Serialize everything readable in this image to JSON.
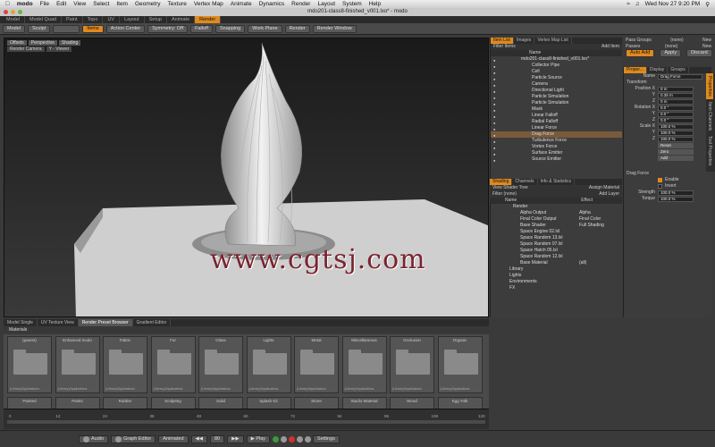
{
  "menubar": {
    "app": "modo",
    "items": [
      "File",
      "Edit",
      "View",
      "Select",
      "Item",
      "Geometry",
      "Texture",
      "Vertex Map",
      "Animate",
      "Dynamics",
      "Render",
      "Layout",
      "System",
      "Help"
    ],
    "clock": "Wed Nov 27  9:20 PM"
  },
  "window": {
    "title": "mdo201-class8-finished_v001.lxo* - modo"
  },
  "layout_tabs": [
    "Model",
    "Model Quad",
    "Paint",
    "Topo",
    "UV",
    "Layout",
    "Setup",
    "Animate",
    "Render"
  ],
  "toolbar": {
    "mode": "Model",
    "sculpt": "Sculpt",
    "items": "Items",
    "action_center": "Action Center",
    "symmetry": "Symmetry: Off",
    "falloff": "Falloff",
    "snapping": "Snapping",
    "work_plane": "Work Plane",
    "render": "Render",
    "render_window": "Render Window"
  },
  "viewport": {
    "tabs": [
      "Offsets",
      "Perspective",
      "Shading"
    ],
    "tabs2": [
      "Render Camera",
      "Y - Viewer"
    ],
    "watermark": "www.cgtsj.com"
  },
  "items_panel": {
    "tabs": [
      "Item List",
      "Images",
      "Vertex Map List"
    ],
    "filter": "Filter Items",
    "add": "Add Item",
    "header": "Name",
    "rows": [
      "mdo201-class8-finished_v001.lxo*",
      "Collector Pipe",
      "Cell",
      "Particle Source",
      "Camera",
      "Directional Light",
      "Particle Simulation",
      "Particle Simulation",
      "Mask",
      "Linear Falloff",
      "Radial Falloff",
      "Linear Force",
      "Drag Force",
      "Turbulence Force",
      "Vortex Force",
      "Surface Emitter",
      "Source Emitter"
    ],
    "selected": 12
  },
  "shading_panel": {
    "tabs": [
      "Shading",
      "Channels",
      "Info & Statistics"
    ],
    "view_label": "View",
    "view_value": "Shader Tree",
    "assign": "Assign Material",
    "filter_label": "Filter",
    "filter_value": "(none)",
    "add_layer": "Add Layer",
    "col_name": "Name",
    "col_effect": "Effect",
    "rows": [
      {
        "name": "Render",
        "effect": ""
      },
      {
        "name": "Alpha Output",
        "effect": "Alpha"
      },
      {
        "name": "Final Color Output",
        "effect": "Final Color"
      },
      {
        "name": "Base Shader",
        "effect": "Full Shading"
      },
      {
        "name": "Space Engine 02.lxl",
        "effect": ""
      },
      {
        "name": "Space Random 13.lxl",
        "effect": ""
      },
      {
        "name": "Space Random 07.lxl",
        "effect": ""
      },
      {
        "name": "Space Hatch 05.lxl",
        "effect": ""
      },
      {
        "name": "Space Random 12.lxl",
        "effect": ""
      },
      {
        "name": "Base Material",
        "effect": "(all)"
      },
      {
        "name": "Library",
        "effect": ""
      },
      {
        "name": "Lights",
        "effect": ""
      },
      {
        "name": "Environments",
        "effect": ""
      },
      {
        "name": "FX",
        "effect": ""
      }
    ]
  },
  "top_right": {
    "pass_groups": "Pass Groups",
    "passes": "Passes",
    "none1": "(none)",
    "none2": "(none)",
    "new": "New",
    "auto_add": "Auto Add",
    "apply": "Apply",
    "discard": "Discard"
  },
  "properties": {
    "tabs": [
      "Proper...",
      "Display",
      "Groups"
    ],
    "name_label": "Name",
    "name_value": "Drag Force",
    "transform": "Transform",
    "position_label": "Position X",
    "position": [
      "0 m",
      "0.35 m",
      "0 m"
    ],
    "rotation_label": "Rotation X",
    "rotation": [
      "0.0 °",
      "0.0 °",
      "0.0 °"
    ],
    "scale_label": "Scale X",
    "scale": [
      "100.0 %",
      "100.0 %",
      "100.0 %"
    ],
    "reset": "Reset",
    "zero": "Zero",
    "add": "Add",
    "drag_force": "Drag Force",
    "enable": "Enable",
    "invert": "Invert",
    "strength_label": "Strength",
    "strength": "100.0 %",
    "torque_label": "Torque",
    "torque": "100.0 %"
  },
  "side_tabs": [
    "Properties",
    "Item Channels",
    "Tool Properties"
  ],
  "bottom_tabs": [
    "Model Single",
    "UV Texture View",
    "Render Preset Browser",
    "Gradient Editor"
  ],
  "preset_path": "Materials",
  "preset_folders": [
    "(parent)",
    "Enhanced modo",
    "Fabric",
    "Fur",
    "Glass",
    "Lights",
    "Metal",
    "Miscellaneous",
    "Occlusion",
    "Organic"
  ],
  "preset_folders_row2": [
    "Painted",
    "Paints",
    "Rubber",
    "Sculpting",
    "Solid",
    "Splash Kit",
    "Stone",
    "Studio Material",
    "Wood",
    "Egg Yolk"
  ],
  "preset_path_label": "(Library)/Applications",
  "timeline_ticks": [
    "0",
    "12",
    "24",
    "36",
    "48",
    "60",
    "72",
    "84",
    "96",
    "108",
    "120"
  ],
  "playbar": {
    "audio": "Audio",
    "graph": "Graph Editor",
    "animated": "Animated",
    "frame": "80",
    "play": "Play",
    "settings": "Settings"
  }
}
